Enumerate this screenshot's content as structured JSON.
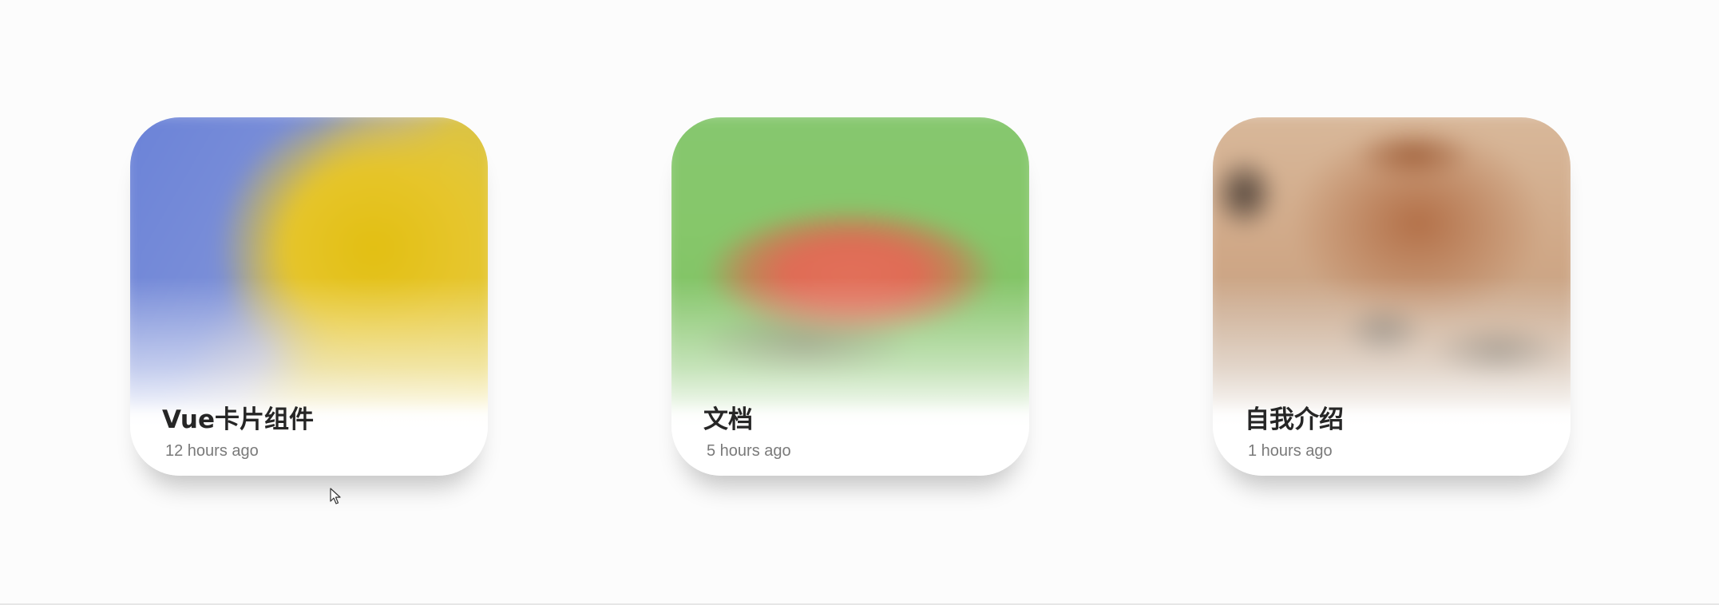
{
  "cards": [
    {
      "title": "Vue卡片组件",
      "time": "12 hours ago",
      "image": "yellow-blue-abstract-thumbnail"
    },
    {
      "title": "文档",
      "time": "5 hours ago",
      "image": "watermelon-thumbnail"
    },
    {
      "title": "自我介绍",
      "time": "1 hours ago",
      "image": "brown-blurred-photo-thumbnail"
    }
  ],
  "icons": {
    "cursor": "mouse-pointer-icon"
  },
  "colors": {
    "background": "#fcfcfc",
    "card": "#ffffff",
    "title": "#262626",
    "time": "#7a7a7a"
  }
}
